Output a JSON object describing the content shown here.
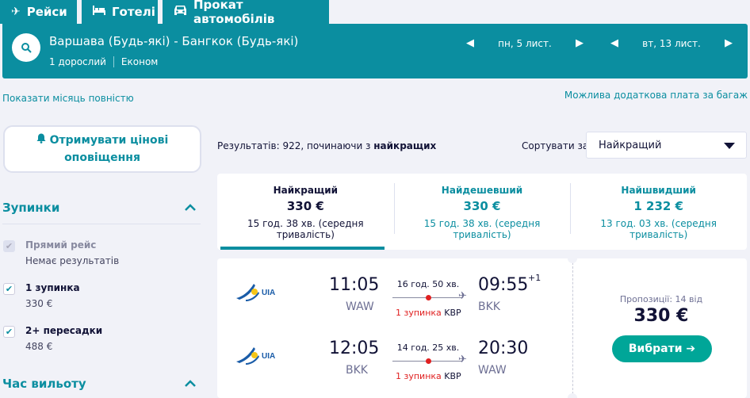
{
  "tabs": [
    {
      "label": "Рейси",
      "icon": "plane-icon"
    },
    {
      "label": "Готелі",
      "icon": "bed-icon"
    },
    {
      "label": "Прокат автомобілів",
      "icon": "car-icon"
    }
  ],
  "search": {
    "route": "Варшава (Будь-які) - Бангкок (Будь-які)",
    "passengers": "1 дорослий",
    "cabin": "Економ",
    "depart_date": "пн, 5 лист.",
    "return_date": "вт, 13 лист."
  },
  "links": {
    "show_month": "Показати місяць повністю",
    "baggage": "Можлива додаткова плата за багаж"
  },
  "sidebar": {
    "alert_line1": "Отримувати цінові",
    "alert_line2": "оповіщення",
    "stops_heading": "Зупинки",
    "departure_heading": "Час вильоту",
    "options": [
      {
        "label": "Прямий рейс",
        "sub": "Немає результатів",
        "checked": true,
        "disabled": true
      },
      {
        "label": "1 зупинка",
        "sub": "330 €",
        "checked": true,
        "disabled": false
      },
      {
        "label": "2+ пересадки",
        "sub": "488 €",
        "checked": true,
        "disabled": false
      }
    ]
  },
  "results": {
    "count_prefix": "Результатів: 922, починаючи з ",
    "count_bold": "найкращих",
    "sort_label": "Сортувати за",
    "sort_value": "Найкращий"
  },
  "summary": [
    {
      "title": "Найкращий",
      "price": "330 €",
      "duration": "15 год. 38 хв. (середня тривалість)"
    },
    {
      "title": "Найдешевший",
      "price": "330 €",
      "duration": "15 год. 38 хв. (середня тривалість)"
    },
    {
      "title": "Найшвидший",
      "price": "1 232 €",
      "duration": "13 год. 03 хв. (середня тривалість)"
    }
  ],
  "card": {
    "airline": "UIA",
    "legs": [
      {
        "dep_time": "11:05",
        "dep_code": "WAW",
        "arr_time": "09:55",
        "arr_code": "BKK",
        "plus_days": "+1",
        "duration": "16 год. 50 хв.",
        "stops": "1 зупинка",
        "via": "KBP"
      },
      {
        "dep_time": "12:05",
        "dep_code": "BKK",
        "arr_time": "20:30",
        "arr_code": "WAW",
        "plus_days": "",
        "duration": "14 год. 25 хв.",
        "stops": "1 зупинка",
        "via": "KBP"
      }
    ],
    "offers": "Пропозиції: 14 від",
    "price": "330 €",
    "select_label": "Вибрати ➔"
  },
  "colors": {
    "teal": "#0b8ea0",
    "blue": "#0770e3",
    "green": "#00a698",
    "red": "#e02020"
  }
}
